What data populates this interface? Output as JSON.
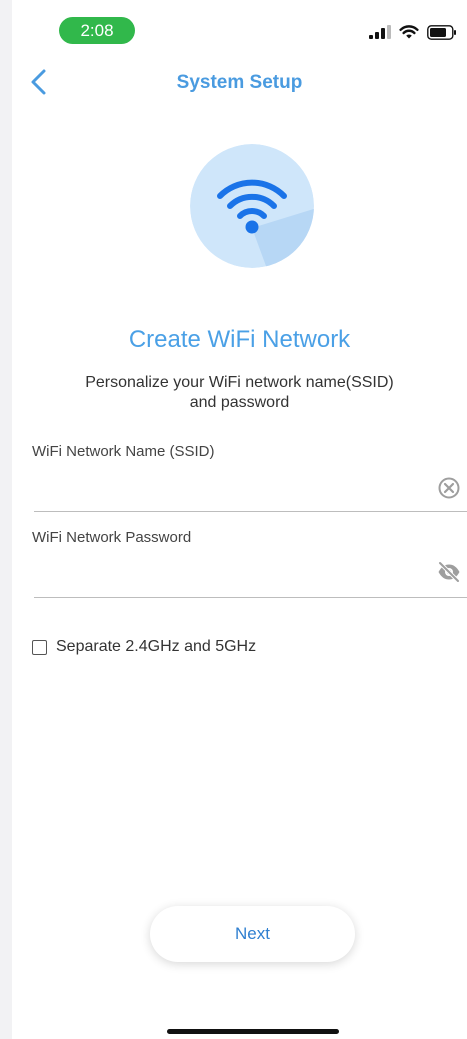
{
  "status_bar": {
    "time": "2:08",
    "icons": [
      "cellular-signal-icon",
      "wifi-icon",
      "battery-icon"
    ]
  },
  "nav": {
    "back_icon": "chevron-left-icon",
    "title": "System Setup"
  },
  "hero": {
    "icon": "wifi-icon"
  },
  "content": {
    "heading": "Create WiFi Network",
    "subtitle_line1": "Personalize your WiFi network name(SSID)",
    "subtitle_line2": "and password"
  },
  "form": {
    "ssid": {
      "label": "WiFi Network Name (SSID)",
      "value": "",
      "icon": "clear-icon"
    },
    "password": {
      "label": "WiFi Network Password",
      "value": "",
      "icon": "eye-off-icon"
    },
    "separate_bands": {
      "label": "Separate 2.4GHz and 5GHz",
      "checked": false
    }
  },
  "actions": {
    "next_label": "Next"
  },
  "colors": {
    "accent": "#4a9be0",
    "status_green": "#31b84b",
    "hero_bg": "#cfe6fa",
    "wifi_blue": "#1a73e8"
  }
}
